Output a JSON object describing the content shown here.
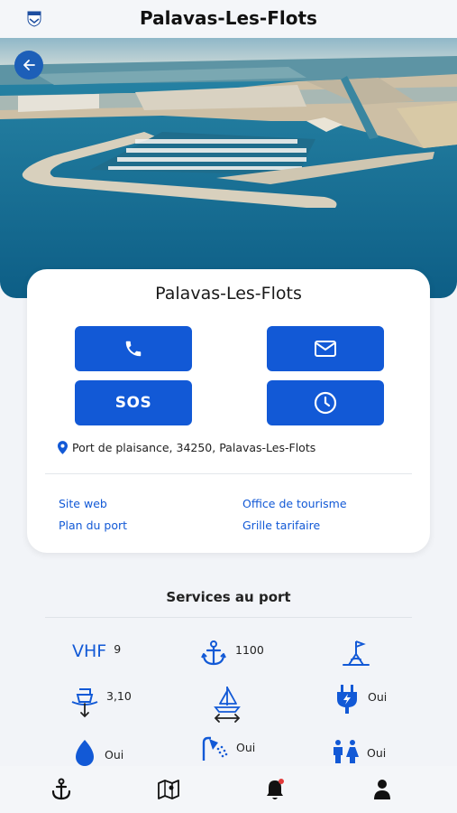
{
  "header": {
    "title": "Palavas-Les-Flots"
  },
  "port": {
    "name": "Palavas-Les-Flots",
    "address": "Port de plaisance, 34250, Palavas-Les-Flots",
    "sos_label": "SOS"
  },
  "links": {
    "website": "Site web",
    "tourism_office": "Office de tourisme",
    "port_plan": "Plan du port",
    "price_grid": "Grille tarifaire"
  },
  "services": {
    "title": "Services au port",
    "vhf_label": "VHF",
    "vhf_channel": "9",
    "moorings": "1100",
    "draft": "3,10",
    "electricity": "Oui",
    "fuel": "Oui",
    "showers": "Oui",
    "toilets": "Oui"
  },
  "colors": {
    "primary": "#1259d6",
    "back_button": "#1d5fb8"
  }
}
